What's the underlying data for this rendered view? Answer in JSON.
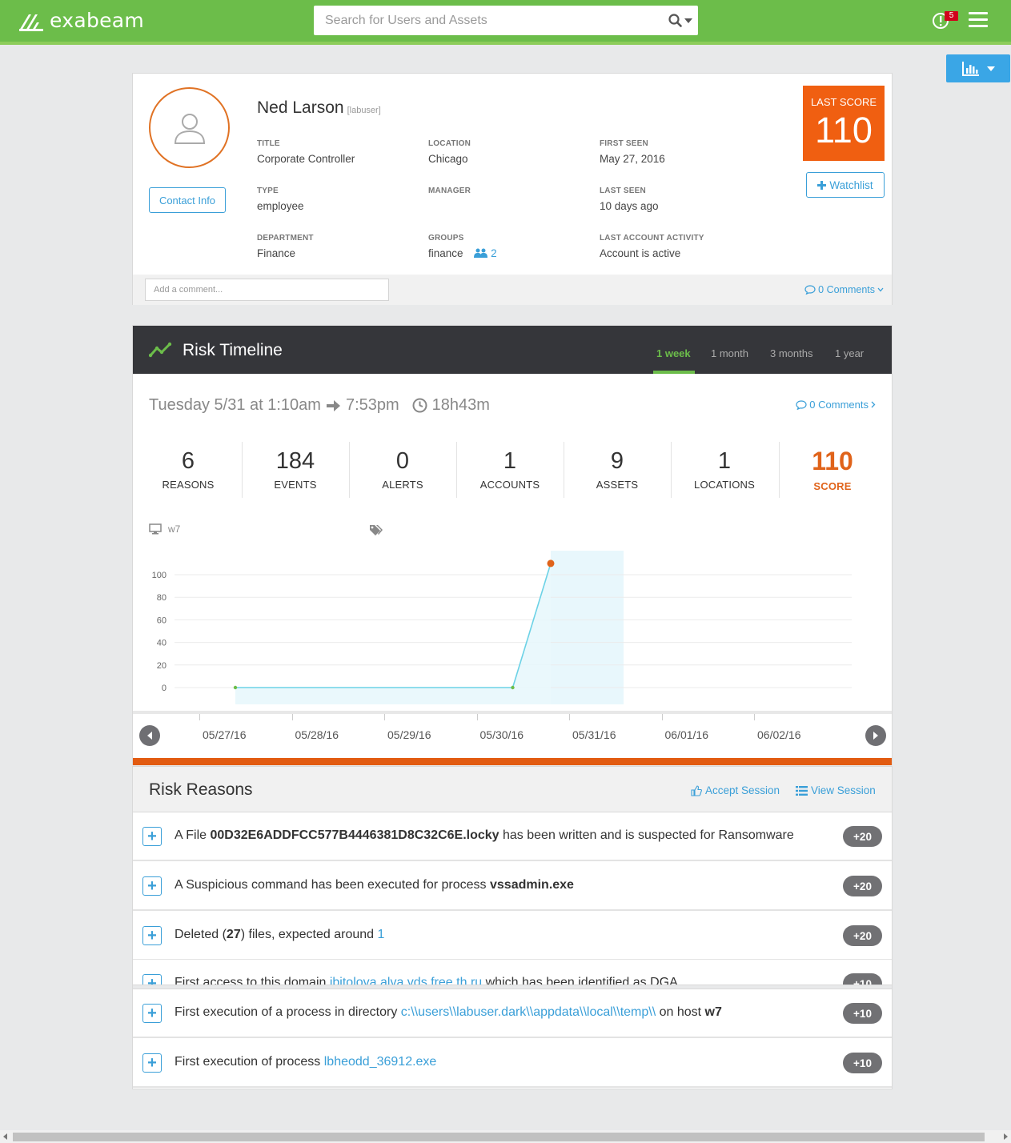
{
  "brand": {
    "name": "exabeam",
    "logo_icon": "exabeam-logo-icon"
  },
  "search": {
    "placeholder": "Search for Users and Assets"
  },
  "header": {
    "alert_count": "5",
    "colors": {
      "topbar": "#6cbd4a",
      "accent": "#3a9fd8",
      "score": "#f05f11"
    }
  },
  "profile": {
    "name": "Ned Larson",
    "username": "[labuser]",
    "contact_label": "Contact Info",
    "fields": {
      "title_label": "TITLE",
      "title_value": "Corporate Controller",
      "location_label": "LOCATION",
      "location_value": "Chicago",
      "first_seen_label": "FIRST SEEN",
      "first_seen_value": "May 27, 2016",
      "type_label": "TYPE",
      "type_value": "employee",
      "manager_label": "MANAGER",
      "manager_value": "",
      "last_seen_label": "LAST SEEN",
      "last_seen_value": "10 days ago",
      "department_label": "DEPARTMENT",
      "department_value": "Finance",
      "groups_label": "GROUPS",
      "groups_value": "finance",
      "groups_count": "2",
      "last_activity_label": "LAST ACCOUNT ACTIVITY",
      "last_activity_value": "Account is active"
    },
    "last_score_label": "LAST SCORE",
    "last_score_value": "110",
    "watchlist_label": "Watchlist",
    "comment_placeholder": "Add a comment...",
    "comments_label": "0 Comments"
  },
  "timeline": {
    "title": "Risk Timeline",
    "tabs": [
      {
        "label": "1 week",
        "active": true
      },
      {
        "label": "1 month",
        "active": false
      },
      {
        "label": "3 months",
        "active": false
      },
      {
        "label": "1 year",
        "active": false
      }
    ],
    "session_start": "Tuesday 5/31 at 1:10am",
    "session_end": "7:53pm",
    "session_duration": "18h43m",
    "comments_label": "0 Comments",
    "stats": [
      {
        "value": "6",
        "label": "REASONS"
      },
      {
        "value": "184",
        "label": "EVENTS"
      },
      {
        "value": "0",
        "label": "ALERTS"
      },
      {
        "value": "1",
        "label": "ACCOUNTS"
      },
      {
        "value": "9",
        "label": "ASSETS"
      },
      {
        "value": "1",
        "label": "LOCATIONS"
      },
      {
        "value": "110",
        "label": "SCORE"
      }
    ],
    "host": "w7"
  },
  "chart_data": {
    "type": "line",
    "title": "",
    "xlabel": "",
    "ylabel": "",
    "y_ticks": [
      "100",
      "80",
      "60",
      "40",
      "20",
      "0"
    ],
    "ylim": [
      0,
      100
    ],
    "x_labels": [
      "05/27/16",
      "05/28/16",
      "05/29/16",
      "05/30/16",
      "05/31/16",
      "06/01/16",
      "06/02/16"
    ],
    "points": [
      {
        "x": "05/27/16",
        "y": 0
      },
      {
        "x": "05/30/16",
        "y": 0
      },
      {
        "x": "05/31/16",
        "y": 110
      }
    ],
    "highlight_session": "05/31/16",
    "grid": true,
    "line_color": "#6cd2e6",
    "point_color_last": "#e0631a"
  },
  "reasons": {
    "title": "Risk Reasons",
    "accept_label": "Accept Session",
    "view_label": "View Session",
    "items": [
      {
        "pre": "A File ",
        "bold": "00D32E6ADDFCC577B4446381D8C32C6E.locky",
        "post": " has been written and is suspected for Ransomware",
        "score": "+20"
      },
      {
        "pre": "A Suspicious command has been executed for process ",
        "bold": "vssadmin.exe",
        "post": "",
        "score": "+20"
      },
      {
        "pre": "Deleted (",
        "bold": "27",
        "post": ") files, expected around ",
        "link": "1",
        "score": "+20"
      },
      {
        "pre": "First access to this domain ",
        "link": "ibitolova.alva.vds.free.th.ru",
        "post": " which has been identified as DGA",
        "score": "+10"
      },
      {
        "pre": "First execution of a process in directory ",
        "link": "c:\\\\users\\\\labuser.dark\\\\appdata\\\\local\\\\temp\\\\",
        "post": " on host ",
        "bold": "w7",
        "score": "+10"
      },
      {
        "pre": "First execution of process ",
        "link": "lbheodd_36912.exe",
        "score": "+10"
      }
    ]
  }
}
